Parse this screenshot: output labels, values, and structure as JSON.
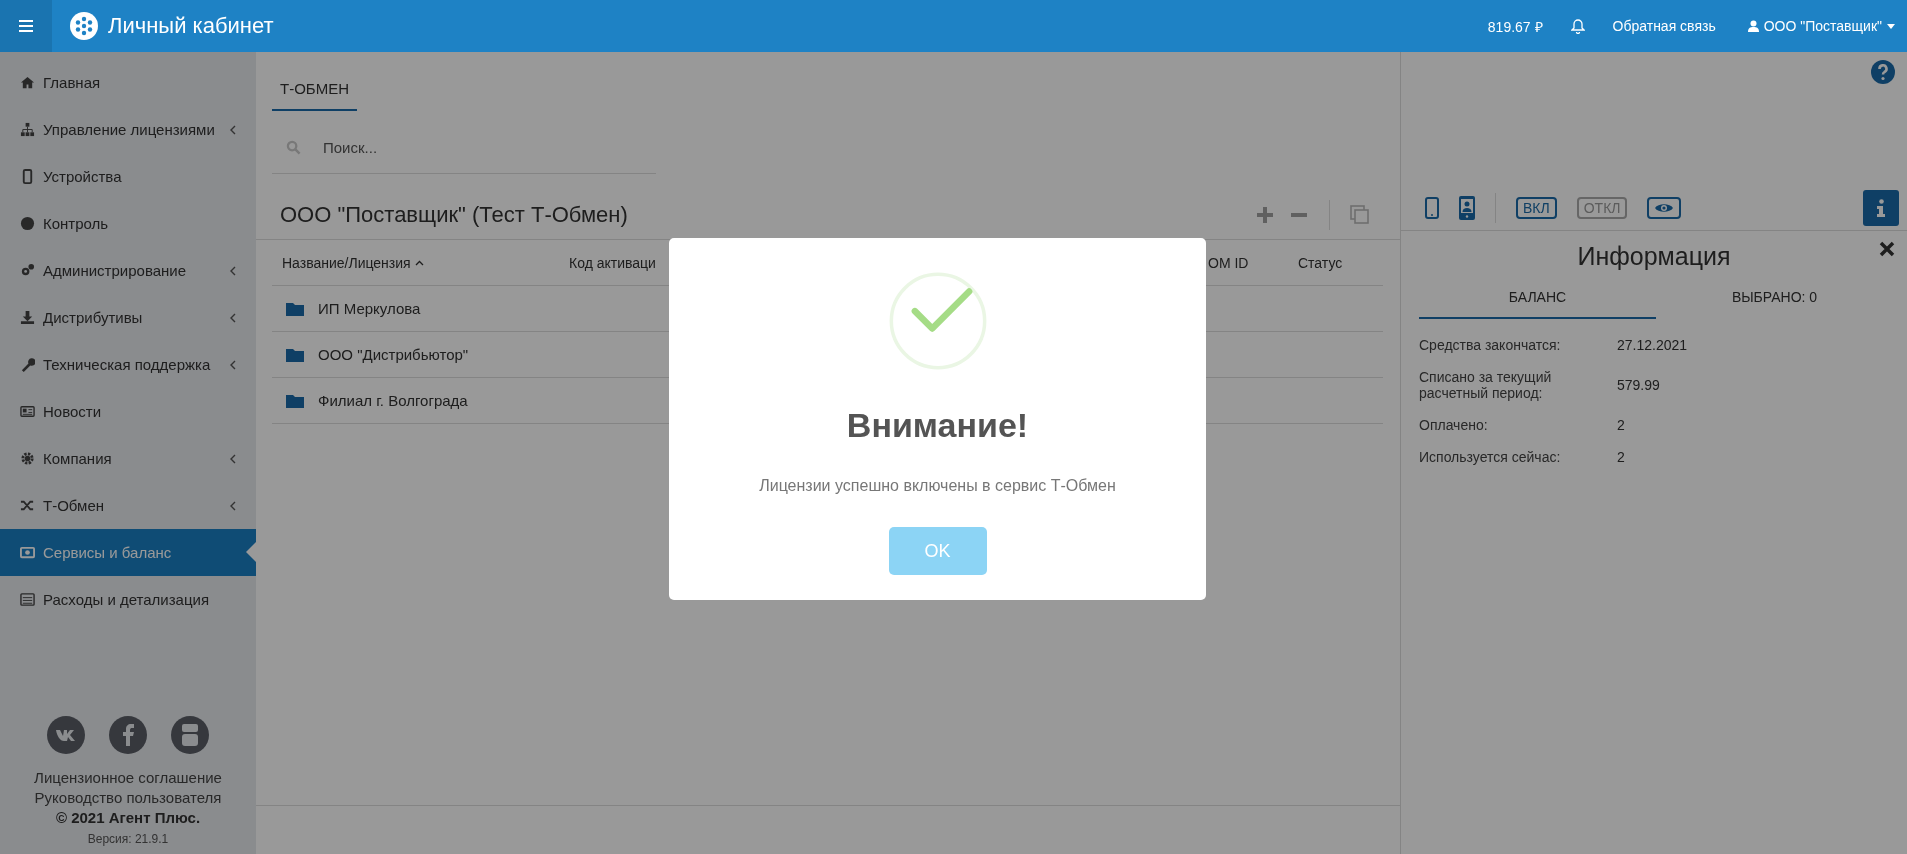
{
  "topbar": {
    "title": "Личный кабинет",
    "balance": "819.67 ₽",
    "feedback": "Обратная связь",
    "user": "ООО \"Поставщик\""
  },
  "sidebar": {
    "items": [
      {
        "label": "Главная",
        "has_submenu": false,
        "selected": false
      },
      {
        "label": "Управление лицензиями",
        "has_submenu": true,
        "selected": false
      },
      {
        "label": "Устройства",
        "has_submenu": false,
        "selected": false
      },
      {
        "label": "Контроль",
        "has_submenu": false,
        "selected": false
      },
      {
        "label": "Администрирование",
        "has_submenu": true,
        "selected": false
      },
      {
        "label": "Дистрибутивы",
        "has_submenu": true,
        "selected": false
      },
      {
        "label": "Техническая поддержка",
        "has_submenu": true,
        "selected": false
      },
      {
        "label": "Новости",
        "has_submenu": false,
        "selected": false
      },
      {
        "label": "Компания",
        "has_submenu": true,
        "selected": false
      },
      {
        "label": "Т-Обмен",
        "has_submenu": true,
        "selected": false
      },
      {
        "label": "Сервисы и баланс",
        "has_submenu": false,
        "selected": true
      },
      {
        "label": "Расходы и детализация",
        "has_submenu": false,
        "selected": false
      }
    ],
    "links": [
      "Лицензионное соглашение",
      "Руководство пользователя"
    ],
    "copyright": "© 2021 Агент Плюс.",
    "version": "Версия: 21.9.1"
  },
  "main": {
    "tabs": [
      {
        "label": "Т-ОБМЕН",
        "selected": true
      }
    ],
    "search": {
      "placeholder": "Поиск..."
    },
    "title": "ООО \"Поставщик\" (Тест Т-Обмен)",
    "table": {
      "columns": [
        "Название/Лицензия",
        "Код активаци",
        "OM ID",
        "Статус"
      ],
      "rows": [
        {
          "name": "ИП Меркулова"
        },
        {
          "name": "ООО \"Дистрибьютор\""
        },
        {
          "name": "Филиал г. Волгограда"
        }
      ]
    }
  },
  "info_panel": {
    "on_button": {
      "label": "ВКЛ",
      "disabled": false
    },
    "off_button": {
      "label": "ОТКЛ",
      "disabled": true
    },
    "title": "Информация",
    "tabs": [
      {
        "label": "БАЛАНС",
        "selected": true
      },
      {
        "label": "ВЫБРАНО: 0",
        "selected": false
      }
    ],
    "rows": [
      {
        "label": "Средства закончатся:",
        "value": "27.12.2021"
      },
      {
        "label": "Списано за текущий расчетный период:",
        "value": "579.99"
      },
      {
        "label": "Оплачено:",
        "value": "2"
      },
      {
        "label": "Используется сейчас:",
        "value": "2"
      }
    ]
  },
  "dialog": {
    "title": "Внимание!",
    "message": "Лицензии успешно включены в сервис Т-Обмен",
    "button": "OK"
  }
}
